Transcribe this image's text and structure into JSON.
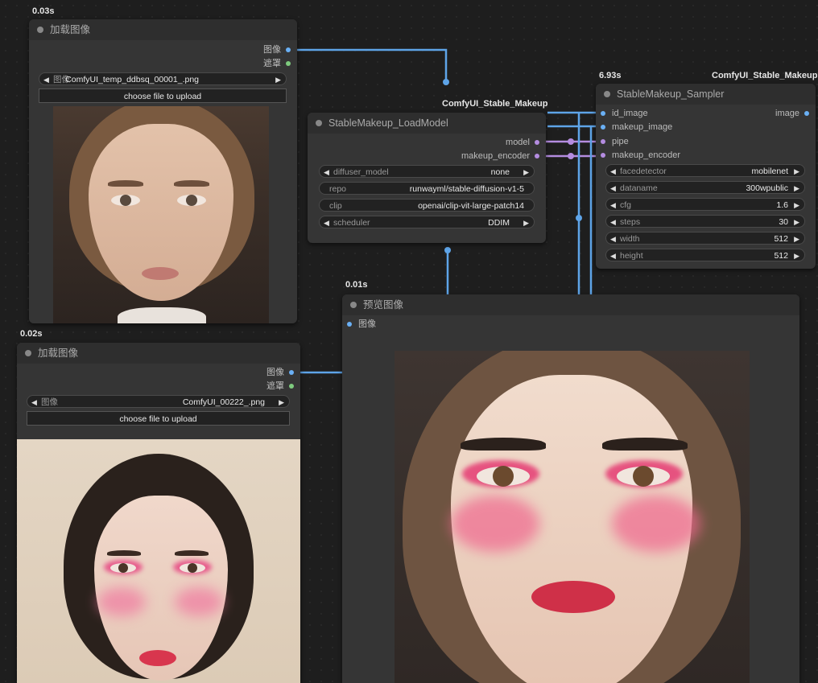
{
  "colors": {
    "link_image": "#5ea4e8",
    "link_model": "#b48ce0",
    "dot_image": "#6ab0f5",
    "dot_mask": "#7ecb7e",
    "dot_model": "#b48ce0"
  },
  "load_image_1": {
    "time": "0.03s",
    "title": "加载图像",
    "out_image": "图像",
    "out_mask": "遮罩",
    "image_label": "图像",
    "image_value": "ComfyUI_temp_ddbsq_00001_.png",
    "upload_label": "choose file to upload"
  },
  "load_image_2": {
    "time": "0.02s",
    "title": "加载图像",
    "out_image": "图像",
    "out_mask": "遮罩",
    "image_label": "图像",
    "image_value": "ComfyUI_00222_.png",
    "upload_label": "choose file to upload"
  },
  "load_model": {
    "group_label": "ComfyUI_Stable_Makeup",
    "title": "StableMakeup_LoadModel",
    "out_model": "model",
    "out_makeup_encoder": "makeup_encoder",
    "widgets": [
      {
        "label": "diffuser_model",
        "value": "none",
        "arrows": true
      },
      {
        "label": "repo",
        "value": "runwayml/stable-diffusion-v1-5",
        "arrows": false
      },
      {
        "label": "clip",
        "value": "openai/clip-vit-large-patch14",
        "arrows": false
      },
      {
        "label": "scheduler",
        "value": "DDIM",
        "arrows": true
      }
    ]
  },
  "sampler": {
    "time": "6.93s",
    "group_label": "ComfyUI_Stable_Makeup",
    "title": "StableMakeup_Sampler",
    "inputs": [
      "id_image",
      "makeup_image",
      "pipe",
      "makeup_encoder"
    ],
    "out_image": "image",
    "widgets": [
      {
        "label": "facedetector",
        "value": "mobilenet"
      },
      {
        "label": "dataname",
        "value": "300wpublic"
      },
      {
        "label": "cfg",
        "value": "1.6"
      },
      {
        "label": "steps",
        "value": "30"
      },
      {
        "label": "width",
        "value": "512"
      },
      {
        "label": "height",
        "value": "512"
      }
    ]
  },
  "preview": {
    "time": "0.01s",
    "title": "预览图像",
    "in_image": "图像"
  }
}
